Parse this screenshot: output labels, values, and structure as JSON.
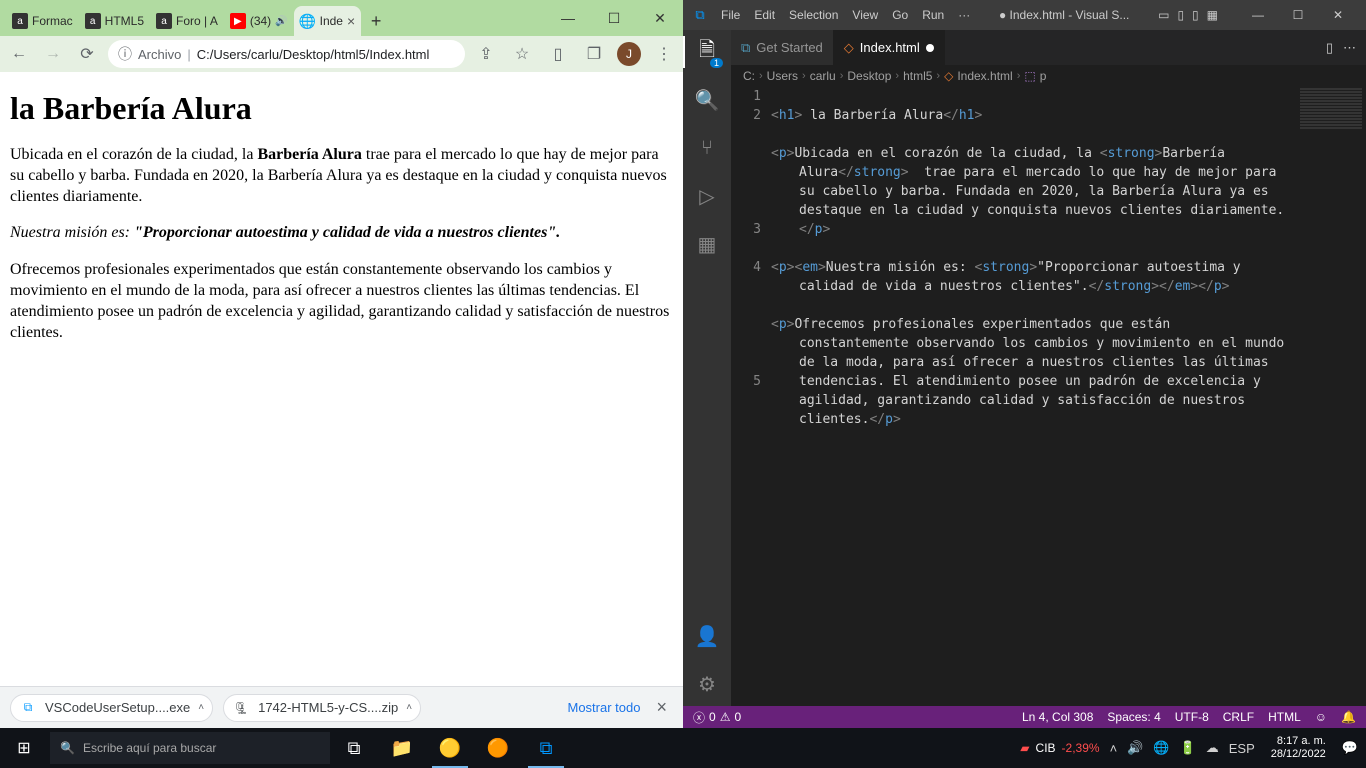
{
  "chrome": {
    "tabs": [
      {
        "label": "Formac",
        "fav": "a"
      },
      {
        "label": "HTML5",
        "fav": "a"
      },
      {
        "label": "Foro | A",
        "fav": "a"
      },
      {
        "label": "(34)",
        "fav": "▶",
        "sound": true
      },
      {
        "label": "Inde",
        "fav": "🌐",
        "active": true
      }
    ],
    "url_label": "Archivo",
    "url_path": "C:/Users/carlu/Desktop/html5/Index.html",
    "avatar_letter": "J",
    "page": {
      "h1": "la Barbería Alura",
      "p1_a": "Ubicada en el corazón de la ciudad, la ",
      "p1_strong": "Barbería Alura",
      "p1_b": " trae para el mercado lo que hay de mejor para su cabello y barba. Fundada en 2020, la Barbería Alura ya es destaque en la ciudad y conquista nuevos clientes diariamente.",
      "p2_em_a": "Nuestra misión es: ",
      "p2_strong": "\"Proporcionar autoestima y calidad de vida a nuestros clientes\".",
      "p3": "Ofrecemos profesionales experimentados que están constantemente observando los cambios y movimiento en el mundo de la moda, para así ofrecer a nuestros clientes las últimas tendencias. El atendimiento posee un padrón de excelencia y agilidad, garantizando calidad y satisfacción de nuestros clientes."
    },
    "downloads": {
      "item1": "VSCodeUserSetup....exe",
      "item2": "1742-HTML5-y-CS....zip",
      "show_all": "Mostrar todo"
    }
  },
  "vscode": {
    "menu": [
      "File",
      "Edit",
      "Selection",
      "View",
      "Go",
      "Run",
      "···"
    ],
    "title": "● Index.html - Visual S...",
    "tabs": {
      "getstarted": "Get Started",
      "index": "Index.html"
    },
    "breadcrumb": [
      "C:",
      "Users",
      "carlu",
      "Desktop",
      "html5",
      "Index.html",
      "p"
    ],
    "lines": {
      "l1": {
        "pre": "<h1>",
        "tx": " la Barbería Alura",
        "post": "</h1>"
      },
      "l2a": "<p>Ubicada en el corazón de la ciudad, la <strong>Barbería Alura</strong>  trae para el mercado lo que hay de mejor para su cabello y barba. Fundada en 2020, la Barbería Alura ya es destaque en la ciudad y conquista nuevos clientes diariamente. </p>",
      "l3": "<p><em>Nuestra misión es: <strong>\"Proporcionar autoestima y calidad de vida a nuestros clientes\".</strong></em></p>",
      "l4": "<p>Ofrecemos profesionales experimentados que están constantemente observando los cambios y movimiento en el mundo de la moda, para así ofrecer a nuestros clientes las últimas tendencias. El atendimiento posee un padrón de excelencia y agilidad, garantizando calidad y satisfacción de nuestros clientes.</p>"
    },
    "status": {
      "errors": "0",
      "warnings": "0",
      "cursor": "Ln 4, Col 308",
      "spaces": "Spaces: 4",
      "encoding": "UTF-8",
      "eol": "CRLF",
      "lang": "HTML"
    },
    "activity_badge": "1"
  },
  "taskbar": {
    "search_placeholder": "Escribe aquí para buscar",
    "stock_name": "CIB",
    "stock_pct": "-2,39%",
    "lang": "ESP",
    "time": "8:17 a. m.",
    "date": "28/12/2022"
  }
}
